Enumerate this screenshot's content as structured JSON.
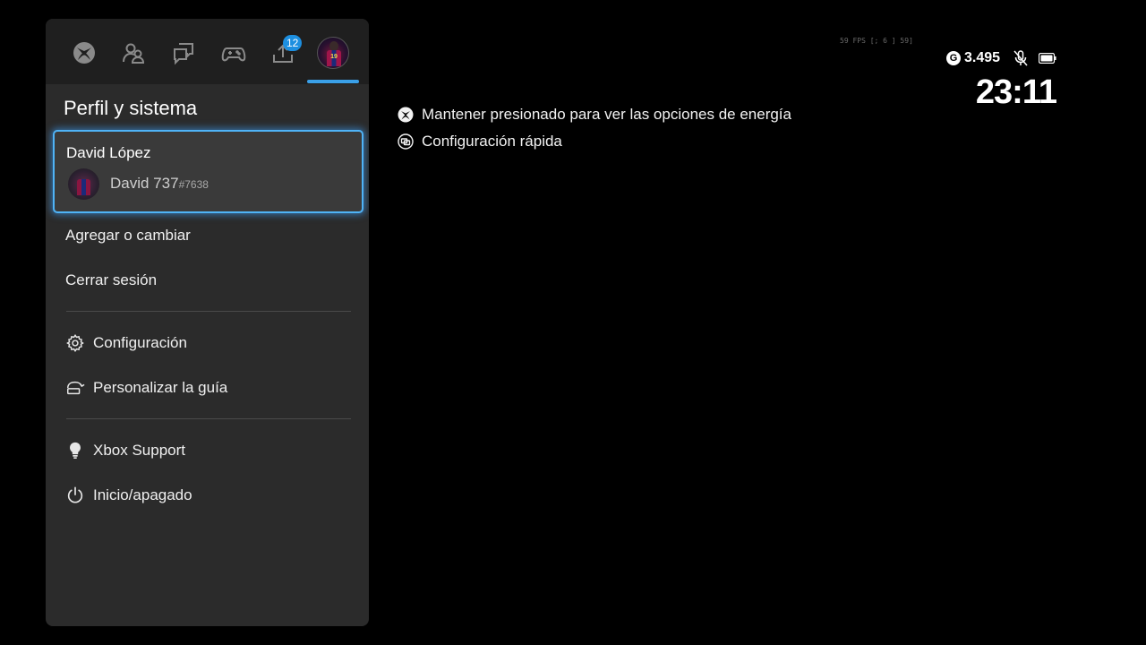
{
  "tabs": [
    {
      "icon": "xbox-logo-icon"
    },
    {
      "icon": "people-icon"
    },
    {
      "icon": "chat-icon"
    },
    {
      "icon": "controller-icon"
    },
    {
      "icon": "upload-icon",
      "badge": "12"
    },
    {
      "icon": "profile-avatar-icon"
    }
  ],
  "panel": {
    "title": "Perfil y sistema",
    "profile": {
      "name": "David López",
      "gamertag": "David 737",
      "gamertag_suffix": "#7638",
      "jersey_number": "19"
    },
    "menu": {
      "add_switch": "Agregar o cambiar",
      "sign_out": "Cerrar sesión",
      "settings": "Configuración",
      "customize_guide": "Personalizar la guía",
      "support": "Xbox Support",
      "power": "Inicio/apagado"
    }
  },
  "hints": {
    "power_hold": "Mantener presionado para ver las opciones de energía",
    "quick_settings": "Configuración rápida"
  },
  "status": {
    "fps_overlay": "59 FPS [; 6 ] 59]",
    "gamerscore_glyph": "G",
    "gamerscore": "3.495",
    "clock": "23:11"
  },
  "colors": {
    "accent": "#3aa0e8",
    "panel_bg": "#2b2b2b",
    "tabs_bg": "#1f1f1f",
    "focus_border": "#4fb3f6"
  }
}
